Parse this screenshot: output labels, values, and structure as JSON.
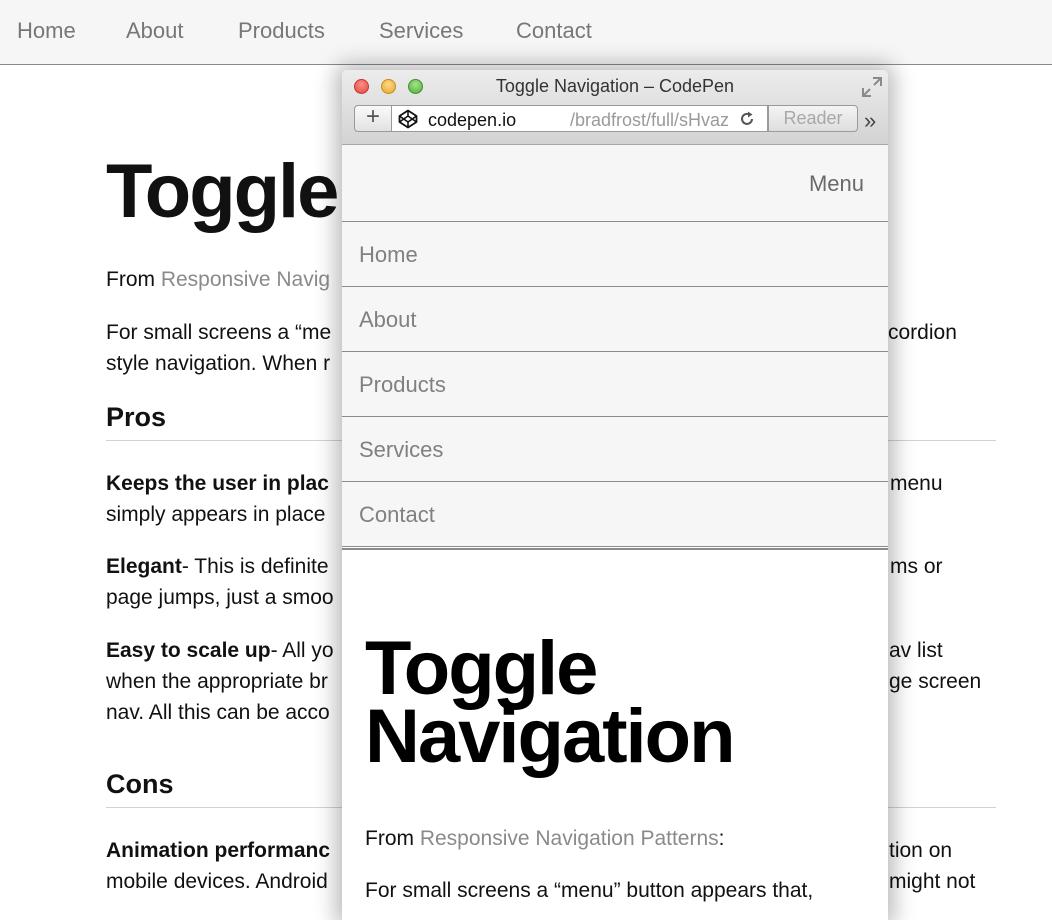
{
  "background": {
    "nav": [
      "Home",
      "About",
      "Products",
      "Services",
      "Contact"
    ],
    "title": "Toggle",
    "from_prefix": "From ",
    "from_link": "Responsive Navig",
    "intro_line1_left": "For small screens a “me",
    "intro_line1_right": "cordion",
    "intro_line2_left": "style navigation. When r",
    "pros_heading": "Pros",
    "pros": [
      {
        "bold": "Keeps the user in plac",
        "rest": "",
        "right": "menu",
        "line2": "simply appears in place"
      },
      {
        "bold": "Elegant",
        "rest": "- This is definite",
        "right": "ms or",
        "line2": "page jumps, just a smoo"
      },
      {
        "bold": "Easy to scale up",
        "rest": "- All yo",
        "right": "av list",
        "line2": "when the appropriate br",
        "line2_right": "ge screen",
        "line3": "nav. All this can be acco"
      }
    ],
    "cons_heading": "Cons",
    "cons": [
      {
        "bold": "Animation performanc",
        "right": "tion on",
        "line2": "mobile devices. Android",
        "line2_right": "might not"
      }
    ]
  },
  "window": {
    "title": "Toggle Navigation – CodePen",
    "add_tab": "+",
    "url_domain": "codepen.io",
    "url_path": "/bradfrost/full/sHvaz",
    "reader": "Reader",
    "overflow": "»",
    "icons": [
      "close-light",
      "minimize-light",
      "zoom-light",
      "fullscreen-icon",
      "codepen-icon",
      "reload-icon",
      "chevron-double-right-icon"
    ]
  },
  "inner_page": {
    "menu_label": "Menu",
    "nav": [
      "Home",
      "About",
      "Products",
      "Services",
      "Contact"
    ],
    "title_line1": "Toggle",
    "title_line2": "Navigation",
    "from_prefix": "From ",
    "from_link": "Responsive Navigation Patterns",
    "from_suffix": ":",
    "para_line1": "For small screens a “menu” button appears that,"
  },
  "colors": {
    "nav_bg": "#f6f6f6",
    "nav_text": "#808080",
    "link": "#8a8a8a",
    "body_text": "#111111"
  }
}
